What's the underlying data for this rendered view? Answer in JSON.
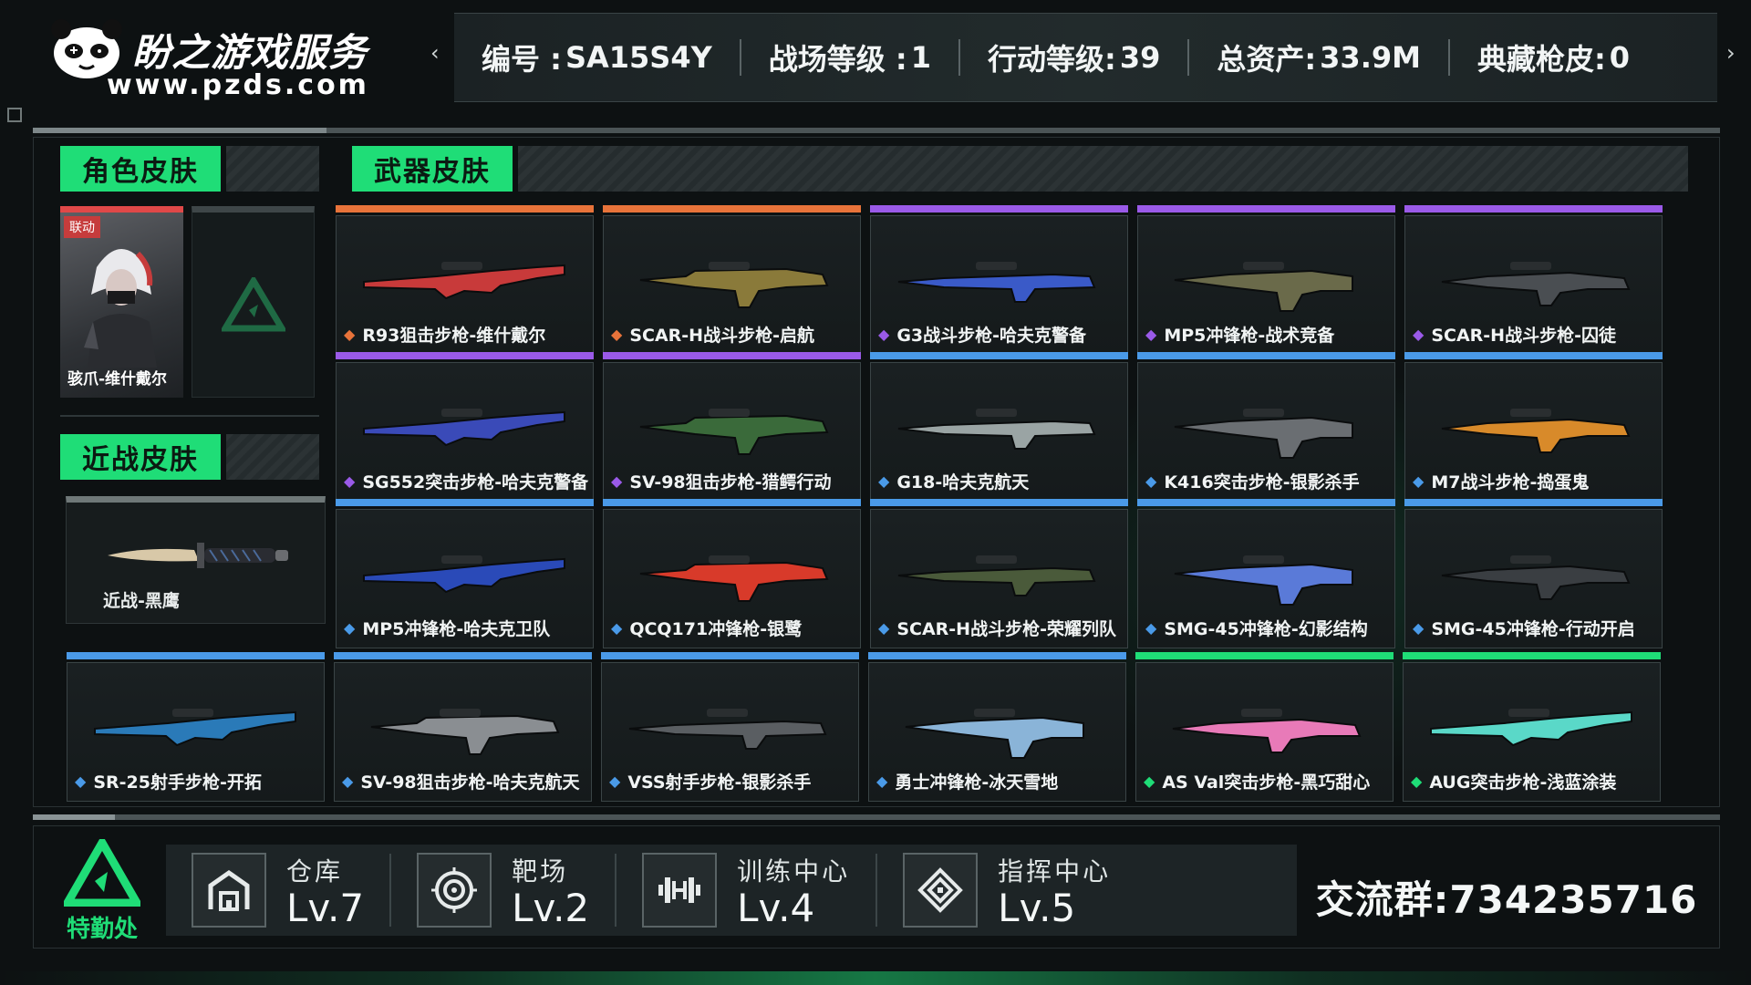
{
  "brand": {
    "name": "盼之游戏服务",
    "url": "www.pzds.com"
  },
  "header": {
    "stats": [
      {
        "label": "编号 :",
        "value": "SA15S4Y"
      },
      {
        "label": "战场等级 :",
        "value": "1"
      },
      {
        "label": "行动等级:",
        "value": "39"
      },
      {
        "label": "总资产:",
        "value": "33.9M"
      },
      {
        "label": "典藏枪皮:",
        "value": "0"
      }
    ]
  },
  "sections": {
    "character": "角色皮肤",
    "melee": "近战皮肤",
    "weapon": "武器皮肤"
  },
  "character_skins": [
    {
      "name": "骇爪-维什戴尔",
      "badge": "联动",
      "rarity_color": "#e04848"
    }
  ],
  "melee_skins": [
    {
      "name": "近战-黑鹰",
      "rarity_color": "#6f7878"
    }
  ],
  "colors": {
    "accent": "#1fdd77",
    "orange": "#e8733a",
    "purple": "#9a5ae8",
    "blue": "#4a9ae8",
    "green": "#1fdd77"
  },
  "weapon_skins": [
    {
      "name": "R93狙击步枪-维什戴尔",
      "rarity": "orange",
      "rarity_color": "#e8733a",
      "gun_color": "#c83a3a"
    },
    {
      "name": "SCAR-H战斗步枪-启航",
      "rarity": "orange",
      "rarity_color": "#e8733a",
      "gun_color": "#8a7a3a"
    },
    {
      "name": "G3战斗步枪-哈夫克警备",
      "rarity": "purple",
      "rarity_color": "#9a5ae8",
      "gun_color": "#3a5ac8"
    },
    {
      "name": "MP5冲锋枪-战术竞备",
      "rarity": "purple",
      "rarity_color": "#9a5ae8",
      "gun_color": "#6a6a4a"
    },
    {
      "name": "SCAR-H战斗步枪-囚徒",
      "rarity": "purple",
      "rarity_color": "#9a5ae8",
      "gun_color": "#4a4e52"
    },
    {
      "name": "SG552突击步枪-哈夫克警备",
      "rarity": "purple",
      "rarity_color": "#9a5ae8",
      "gun_color": "#3a4ab8"
    },
    {
      "name": "SV-98狙击步枪-猎鳄行动",
      "rarity": "purple",
      "rarity_color": "#9a5ae8",
      "gun_color": "#3a6a3a"
    },
    {
      "name": "G18-哈夫克航天",
      "rarity": "blue",
      "rarity_color": "#4a9ae8",
      "gun_color": "#9aa4a4"
    },
    {
      "name": "K416突击步枪-银影杀手",
      "rarity": "blue",
      "rarity_color": "#4a9ae8",
      "gun_color": "#6a6e72"
    },
    {
      "name": "M7战斗步枪-捣蛋鬼",
      "rarity": "blue",
      "rarity_color": "#4a9ae8",
      "gun_color": "#d88a2a"
    },
    {
      "name": "MP5冲锋枪-哈夫克卫队",
      "rarity": "blue",
      "rarity_color": "#4a9ae8",
      "gun_color": "#2a4ab8"
    },
    {
      "name": "QCQ171冲锋枪-银鹭",
      "rarity": "blue",
      "rarity_color": "#4a9ae8",
      "gun_color": "#d83a2a"
    },
    {
      "name": "SCAR-H战斗步枪-荣耀列队",
      "rarity": "blue",
      "rarity_color": "#4a9ae8",
      "gun_color": "#4a5a3a"
    },
    {
      "name": "SMG-45冲锋枪-幻影结构",
      "rarity": "blue",
      "rarity_color": "#4a9ae8",
      "gun_color": "#5a7ad8"
    },
    {
      "name": "SMG-45冲锋枪-行动开启",
      "rarity": "blue",
      "rarity_color": "#4a9ae8",
      "gun_color": "#3a3e42"
    },
    {
      "name": "SR-25射手步枪-开拓",
      "rarity": "blue",
      "rarity_color": "#4a9ae8",
      "gun_color": "#2a7ab8"
    },
    {
      "name": "SV-98狙击步枪-哈夫克航天",
      "rarity": "blue",
      "rarity_color": "#4a9ae8",
      "gun_color": "#8a8e92"
    },
    {
      "name": "VSS射手步枪-银影杀手",
      "rarity": "blue",
      "rarity_color": "#4a9ae8",
      "gun_color": "#5a5e62"
    },
    {
      "name": "勇士冲锋枪-冰天雪地",
      "rarity": "blue",
      "rarity_color": "#4a9ae8",
      "gun_color": "#8ab4d8"
    },
    {
      "name": "AS Val突击步枪-黑巧甜心",
      "rarity": "green",
      "rarity_color": "#1fdd77",
      "gun_color": "#e87ab8"
    },
    {
      "name": "AUG突击步枪-浅蓝涂装",
      "rarity": "green",
      "rarity_color": "#1fdd77",
      "gun_color": "#5ad8c8"
    }
  ],
  "footer": {
    "logo_text": "特勤处",
    "facilities": [
      {
        "name": "仓库",
        "level": "Lv.7",
        "icon": "warehouse-icon"
      },
      {
        "name": "靶场",
        "level": "Lv.2",
        "icon": "target-icon"
      },
      {
        "name": "训练中心",
        "level": "Lv.4",
        "icon": "dumbbell-icon"
      },
      {
        "name": "指挥中心",
        "level": "Lv.5",
        "icon": "command-icon"
      }
    ],
    "group": "交流群:734235716"
  }
}
